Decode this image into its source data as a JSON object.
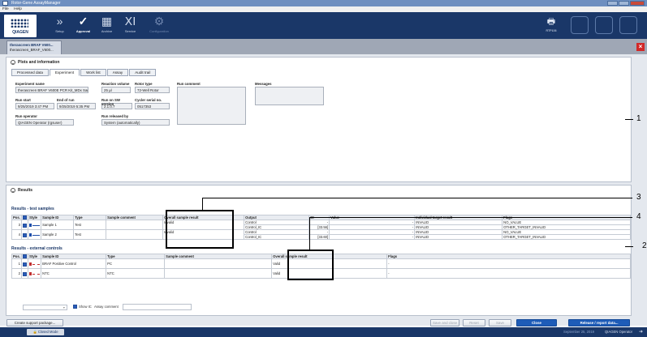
{
  "window": {
    "title": "Rotor-Gene AssayManager"
  },
  "menu": [
    "File",
    "Help"
  ],
  "toolbar": {
    "logo_text": "QIAGEN",
    "nav": [
      {
        "label": "Setup",
        "icon": "arrows-icon",
        "glyph": "»"
      },
      {
        "label": "Approval",
        "icon": "approval-check-icon",
        "glyph": "✓"
      },
      {
        "label": "Archive",
        "icon": "archive-icon",
        "glyph": "▦"
      },
      {
        "label": "Service",
        "icon": "service-icon",
        "glyph": "ⅩⅠ"
      },
      {
        "label": "Configuration",
        "icon": "configuration-icon",
        "glyph": "⚙"
      }
    ],
    "right_label": "RTP106"
  },
  "experiment_tab": {
    "line1": "therascreen BRAF V600...",
    "line2": "therascreen_BRAF_V600..."
  },
  "plots_panel": {
    "title": "Plots and information",
    "tabs": [
      "Processed data",
      "Experiment",
      "Work list",
      "Assay",
      "Audit trail"
    ],
    "selected_tab": "Experiment",
    "fields": {
      "experiment_name": {
        "label": "Experiment name",
        "value": "therascreen BRAF V600E PCR Kit_MDx Sample"
      },
      "reaction_volume": {
        "label": "Reaction volume",
        "value": "25 µl"
      },
      "rotor_type": {
        "label": "Rotor type",
        "value": "72-Well Rotor"
      },
      "run_comment": {
        "label": "Run comment"
      },
      "messages": {
        "label": "Messages"
      },
      "run_start": {
        "label": "Run start",
        "value": "9/25/2019 3:47 PM"
      },
      "end_of_run": {
        "label": "End of run",
        "value": "9/25/2019 5:35 PM"
      },
      "run_on_sw": {
        "label": "Run on SW version",
        "value": "2.1.0.7"
      },
      "cycler_serial": {
        "label": "Cycler serial no.",
        "value": "0517353"
      },
      "run_operator": {
        "label": "Run operator",
        "value": "QIAGEN Operator (rgsuser)"
      },
      "run_released_by": {
        "label": "Run released by",
        "value": "System (automatically)"
      }
    }
  },
  "results_panel": {
    "title": "Results",
    "test_samples_label": "Results - test samples",
    "test_headers": [
      "Pos.",
      "",
      "Style",
      "Sample ID",
      "Type",
      "Sample comment",
      "Overall sample result",
      "Output",
      "Ct",
      "Value",
      "Individual target result",
      "Flags"
    ],
    "test_rows": [
      {
        "pos": "3",
        "sample_id": "Sample 1",
        "type": "Test",
        "overall": "Invalid",
        "outputs": [
          {
            "output": "Control",
            "ct": "-",
            "value": "-",
            "target": "INVALID",
            "flags": "NO_VALUE"
          },
          {
            "output": "Control_IC",
            "ct": "[33.56]",
            "value": "-",
            "target": "INVALID",
            "flags": "OTHER_TARGET_INVALID"
          }
        ]
      },
      {
        "pos": "4",
        "sample_id": "Sample 2",
        "type": "Test",
        "overall": "Invalid",
        "outputs": [
          {
            "output": "Control",
            "ct": "-",
            "value": "-",
            "target": "INVALID",
            "flags": "NO_VALUE"
          },
          {
            "output": "Control_IC",
            "ct": "[33.60]",
            "value": "-",
            "target": "INVALID",
            "flags": "OTHER_TARGET_INVALID"
          }
        ]
      }
    ],
    "external_label": "Results - external controls",
    "ext_headers": [
      "Pos.",
      "",
      "Style",
      "Sample ID",
      "Type",
      "Sample comment",
      "Overall sample result",
      "Flags"
    ],
    "ext_rows": [
      {
        "pos": "1",
        "sample_id": "BRAF Positive Control",
        "type": "PC",
        "overall": "Valid",
        "flags": "-"
      },
      {
        "pos": "2",
        "sample_id": "NTC",
        "type": "NTC",
        "overall": "Valid",
        "flags": "-"
      }
    ],
    "filter_label": "Show IC",
    "assay_comment_label": "Assay comment"
  },
  "callouts": [
    "1",
    "2",
    "3",
    "4"
  ],
  "buttons": {
    "create_support": "Create support package...",
    "save_close": "Save and close",
    "reset": "Reset",
    "save": "Save",
    "close": "Close",
    "release": "Release / report data..."
  },
  "status": {
    "mode": "Closed Mode",
    "date": "September 25, 2019",
    "user": "QIAGEN Operator"
  },
  "colors": {
    "nav_bg": "#1a3768",
    "accent_blue": "#1e5cb8",
    "close_red": "#d22828"
  }
}
